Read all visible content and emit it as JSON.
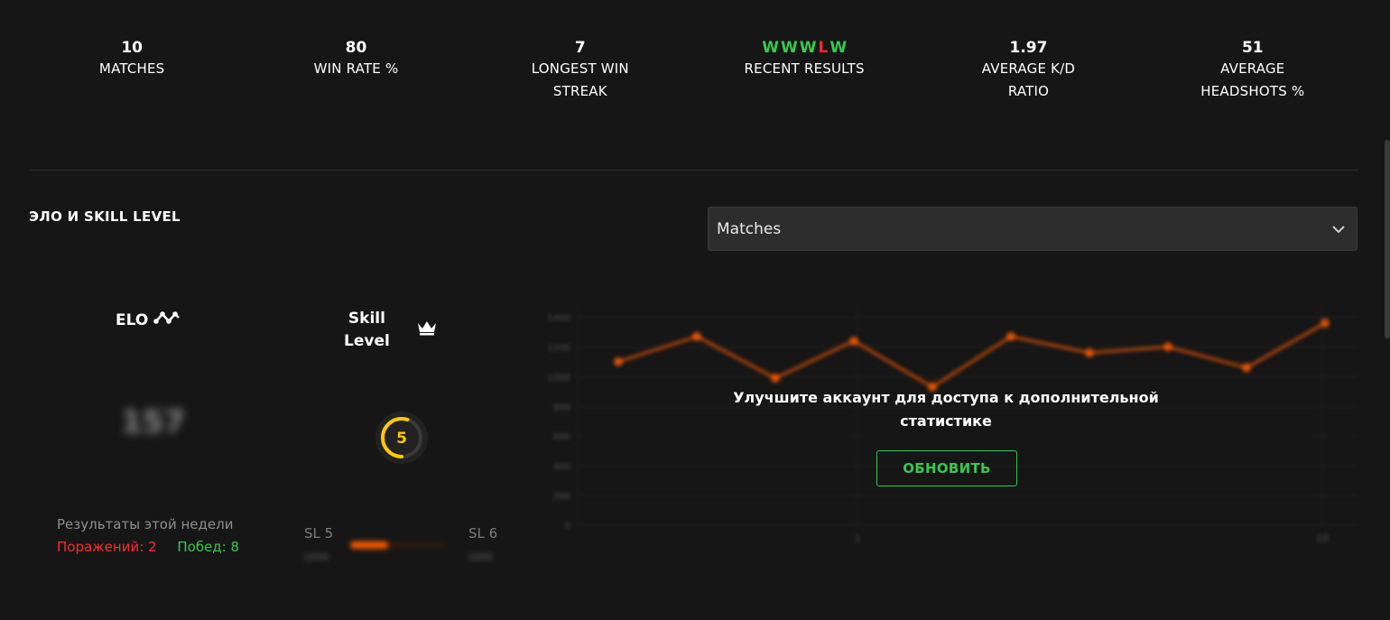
{
  "stats": [
    {
      "value": "10",
      "label": "MATCHES"
    },
    {
      "value": "80",
      "label": "WIN RATE %"
    },
    {
      "value": "7",
      "label": "LONGEST WIN STREAK"
    },
    {
      "value": "",
      "label": "RECENT RESULTS"
    },
    {
      "value": "1.97",
      "label": "AVERAGE K/D RATIO"
    },
    {
      "value": "51",
      "label": "AVERAGE HEADSHOTS %"
    }
  ],
  "recent_results": [
    "W",
    "W",
    "W",
    "L",
    "W"
  ],
  "colors": {
    "win": "#37c94f",
    "loss": "#ff2b2b",
    "accent": "#ff5a00",
    "skill": "#ffc800"
  },
  "section_title": "ЭЛО И SKILL LEVEL",
  "select": {
    "value": "Matches"
  },
  "elo": {
    "label": "ELO",
    "value": "157"
  },
  "skill": {
    "label_line1": "Skill",
    "label_line2": "Level",
    "level": "5",
    "level_fraction": 0.55
  },
  "week": {
    "title": "Результаты этой недели",
    "losses": "Поражений: 2",
    "wins": "Побед: 8"
  },
  "sl_progress": {
    "left_label": "SL 5",
    "right_label": "SL 6",
    "left_sub": "1050",
    "right_sub": "1000",
    "fraction": 0.4
  },
  "chart_data": {
    "type": "line",
    "x": [
      1,
      2,
      3,
      4,
      5,
      6,
      7,
      8,
      9,
      10
    ],
    "values": [
      1100,
      1270,
      990,
      1240,
      930,
      1270,
      1160,
      1200,
      1060,
      1360
    ],
    "ylim": [
      0,
      1500
    ],
    "yticks": [
      "0",
      "200",
      "400",
      "600",
      "800",
      "1000",
      "1200",
      "1400"
    ],
    "xticks": [
      "1",
      "10"
    ],
    "color": "#ff5a00"
  },
  "overlay": {
    "message": "Улучшите аккаунт для доступа к дополнительной статистике",
    "button": "ОБНОВИТЬ"
  }
}
